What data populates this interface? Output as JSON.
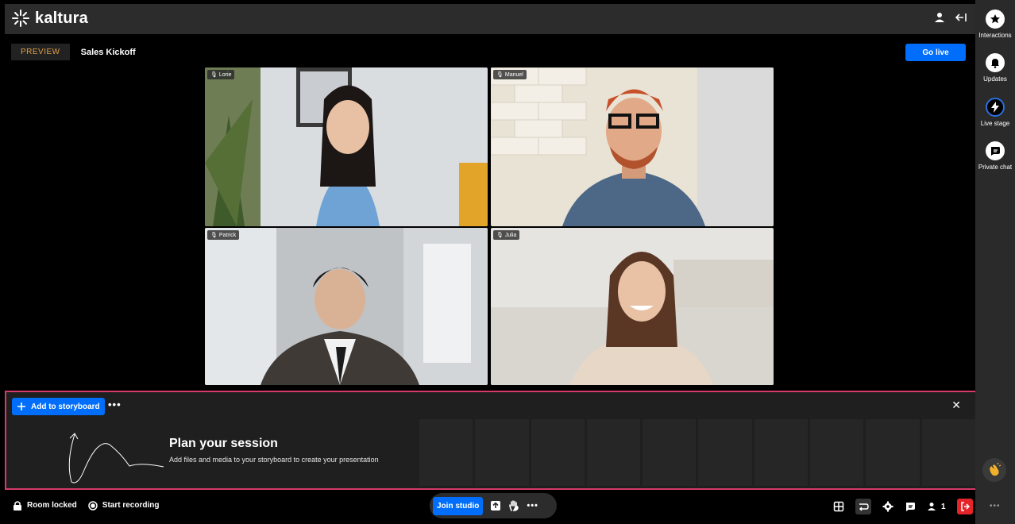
{
  "brand": {
    "name": "kaltura"
  },
  "header": {
    "preview_label": "PREVIEW",
    "session_title": "Sales Kickoff",
    "go_live_label": "Go live"
  },
  "participants": [
    {
      "name": "Lorie"
    },
    {
      "name": "Manuel"
    },
    {
      "name": "Patrick"
    },
    {
      "name": "Julia"
    }
  ],
  "storyboard": {
    "add_label": "Add to storyboard",
    "more_label": "•••",
    "close_label": "✕",
    "title": "Plan your session",
    "subtitle": "Add files and media to your storyboard to create your presentation"
  },
  "bottombar": {
    "room_locked": "Room locked",
    "start_recording": "Start recording",
    "join_studio": "Join studio",
    "more_label": "•••",
    "participant_count": "1"
  },
  "rail": {
    "items": [
      {
        "label": "Interactions",
        "icon": "star-icon"
      },
      {
        "label": "Updates",
        "icon": "bell-icon"
      },
      {
        "label": "Live stage",
        "icon": "lightning-icon"
      },
      {
        "label": "Private chat",
        "icon": "chat-icon"
      }
    ],
    "more_label": "•••"
  },
  "colors": {
    "accent": "#006efa",
    "highlight_border": "#d63a6a",
    "leave": "#e5242a",
    "preview_text": "#e0a048"
  }
}
